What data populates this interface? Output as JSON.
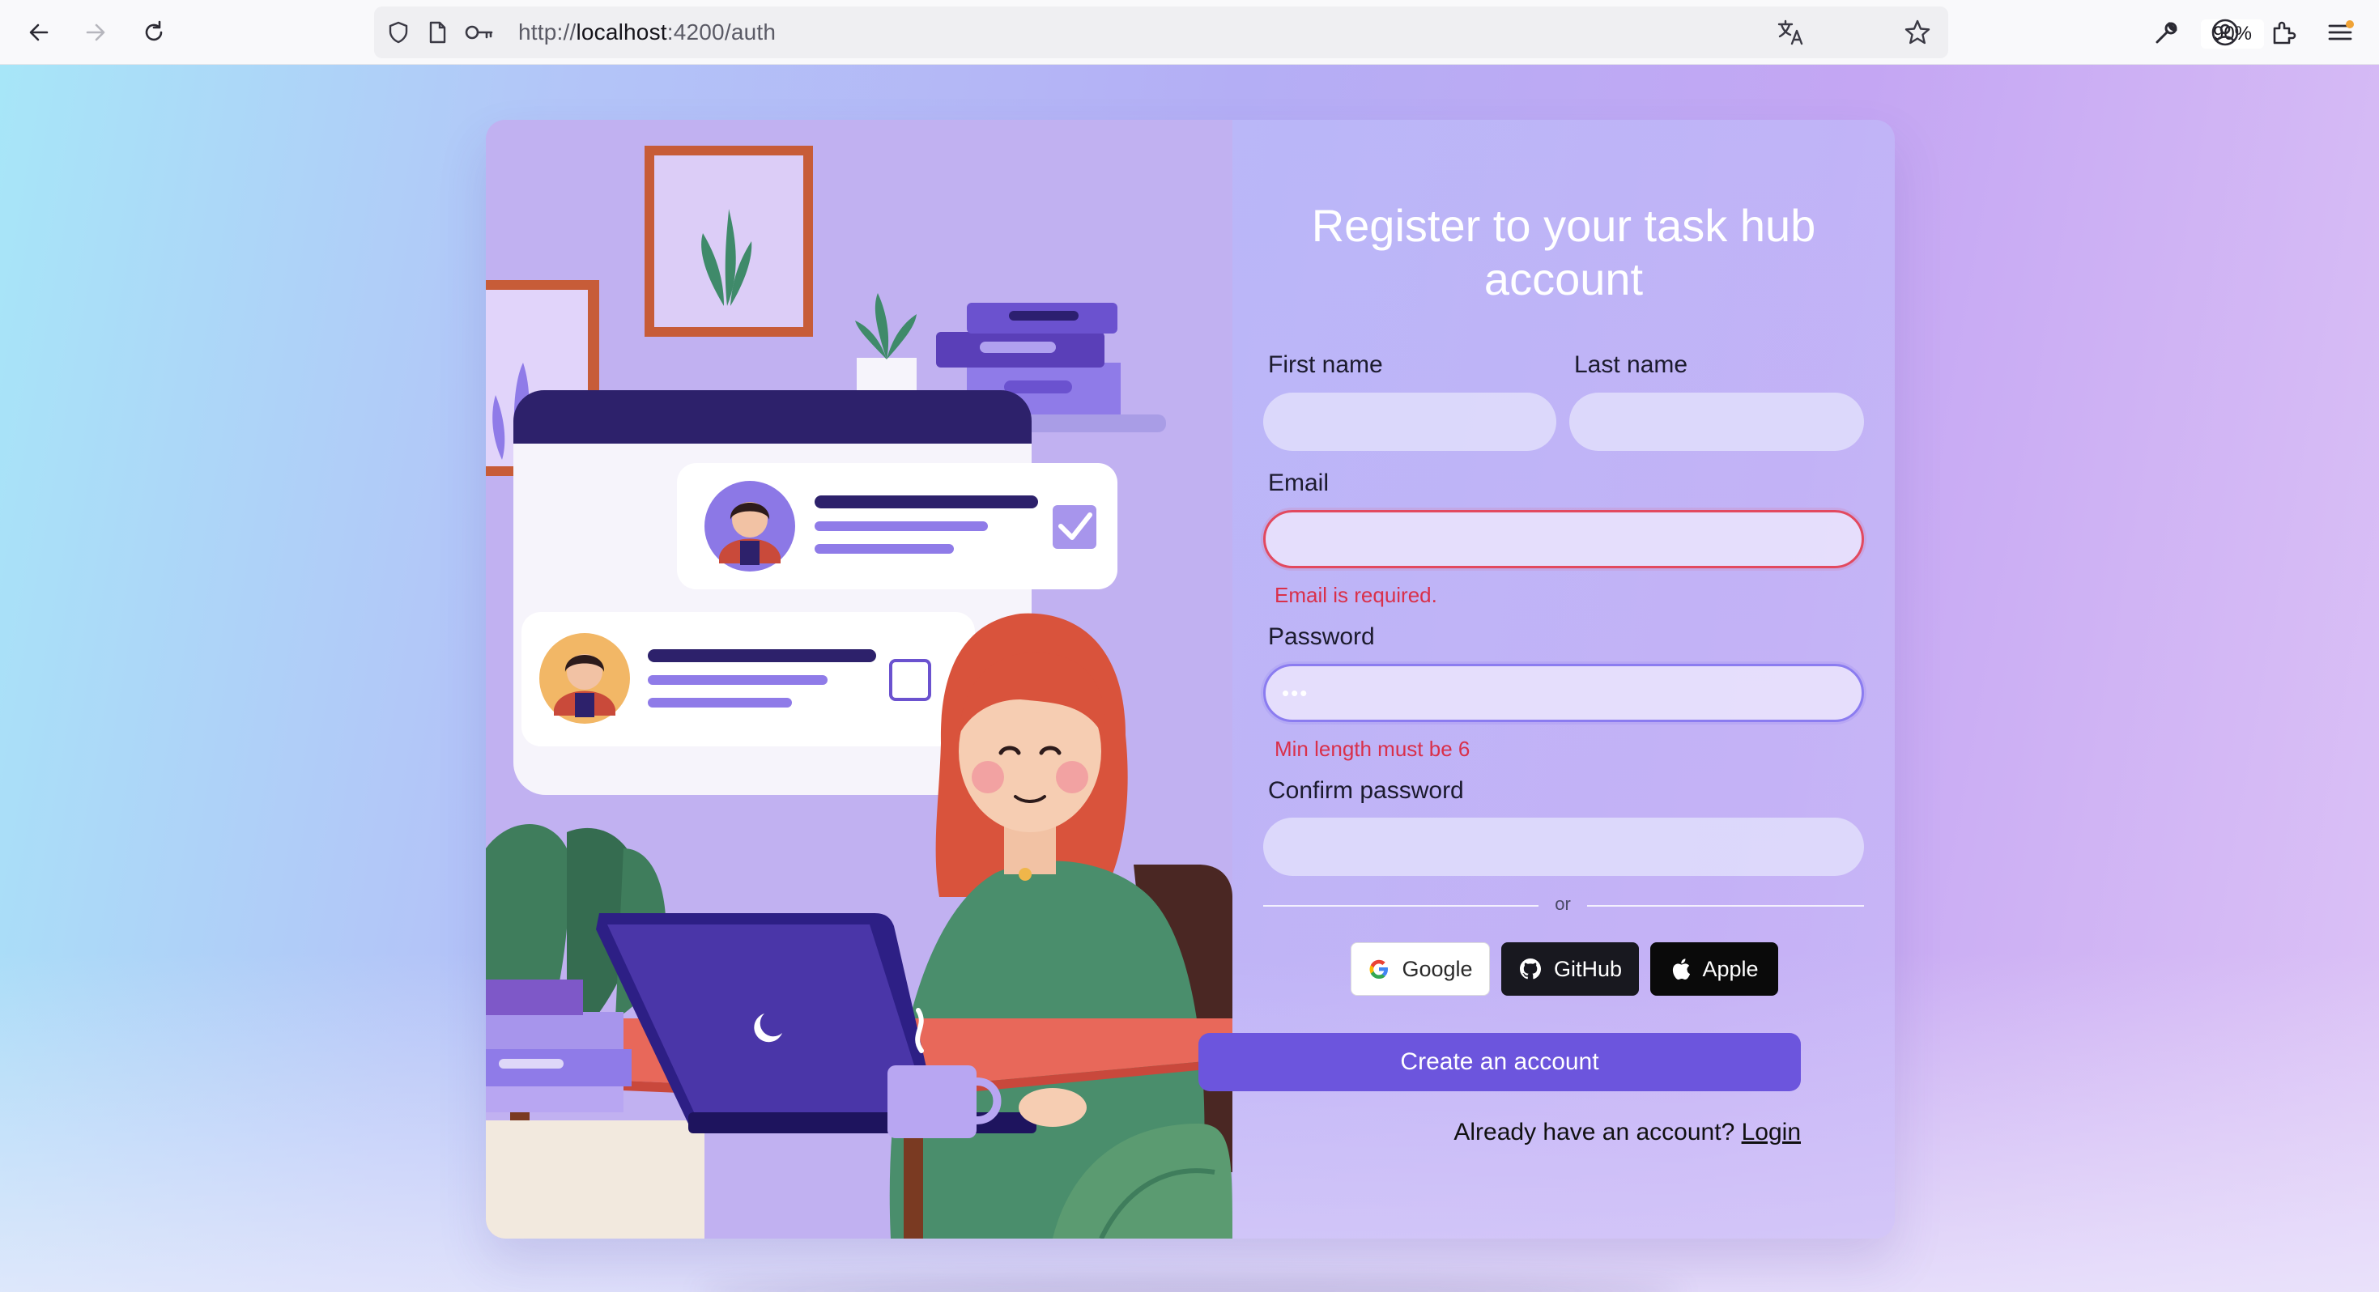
{
  "browser": {
    "url_prefix": "http://",
    "url_host": "localhost",
    "url_rest": ":4200/auth",
    "zoom": "90%"
  },
  "form": {
    "title": "Register to your task hub account",
    "first_name_label": "First name",
    "last_name_label": "Last name",
    "email_label": "Email",
    "email_error": "Email is required.",
    "password_label": "Password",
    "password_value": "•••",
    "password_error": "Min length must be 6",
    "confirm_label": "Confirm password",
    "or_text": "or",
    "google_label": "Google",
    "github_label": "GitHub",
    "apple_label": "Apple",
    "submit_label": "Create an account",
    "login_prompt": "Already have an account?",
    "login_link": "Login"
  },
  "colors": {
    "primary": "#6c55dd",
    "error": "#d9304a",
    "focus": "#8b7cf0"
  },
  "icons": [
    "back-arrow-icon",
    "forward-arrow-icon",
    "reload-icon",
    "shield-icon",
    "page-icon",
    "key-icon",
    "translate-icon",
    "star-icon",
    "wrench-icon",
    "account-icon",
    "extensions-icon",
    "menu-icon",
    "google-logo-icon",
    "github-logo-icon",
    "apple-logo-icon"
  ]
}
